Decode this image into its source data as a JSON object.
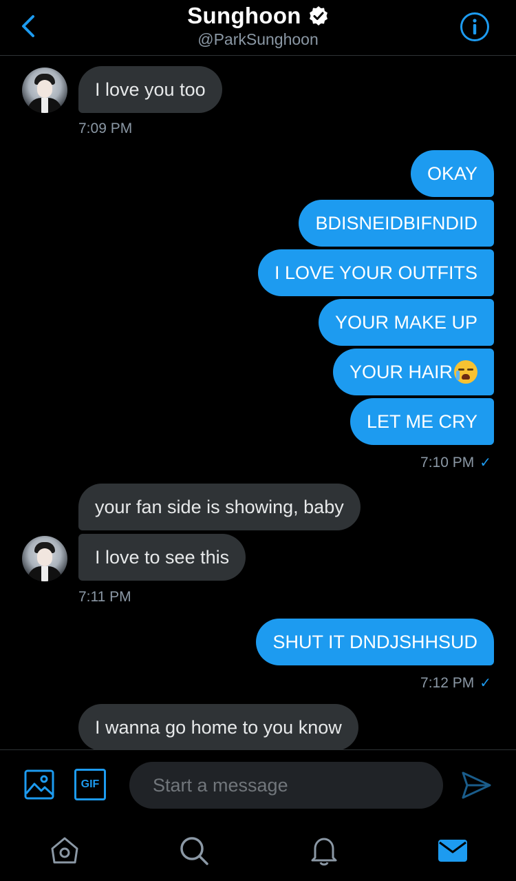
{
  "header": {
    "name": "Sunghoon",
    "handle": "@ParkSunghoon"
  },
  "messages": {
    "m1": "I love you too",
    "t1": "7:09 PM",
    "o1": "OKAY",
    "o2": "BDISNEIDBIFNDID",
    "o3": "I LOVE YOUR OUTFITS",
    "o4": "YOUR MAKE UP",
    "o5": "YOUR HAIR",
    "o6": "LET ME CRY",
    "t2": "7:10 PM",
    "m2": "your fan side is showing, baby",
    "m3": "I love to see this",
    "t3": "7:11 PM",
    "o7": "SHUT IT DNDJSHHSUD",
    "t4": "7:12 PM",
    "m4": "I wanna go home to you know"
  },
  "composer": {
    "placeholder": "Start a message",
    "gif_label": "GIF"
  },
  "colors": {
    "accent": "#1d9bf0",
    "incoming_bubble": "#2f3336",
    "background": "#000000"
  },
  "icons": [
    "chevron-left-icon",
    "verified-badge-icon",
    "info-icon",
    "image-icon",
    "gif-icon",
    "send-icon",
    "home-icon",
    "search-icon",
    "bell-icon",
    "mail-icon"
  ]
}
